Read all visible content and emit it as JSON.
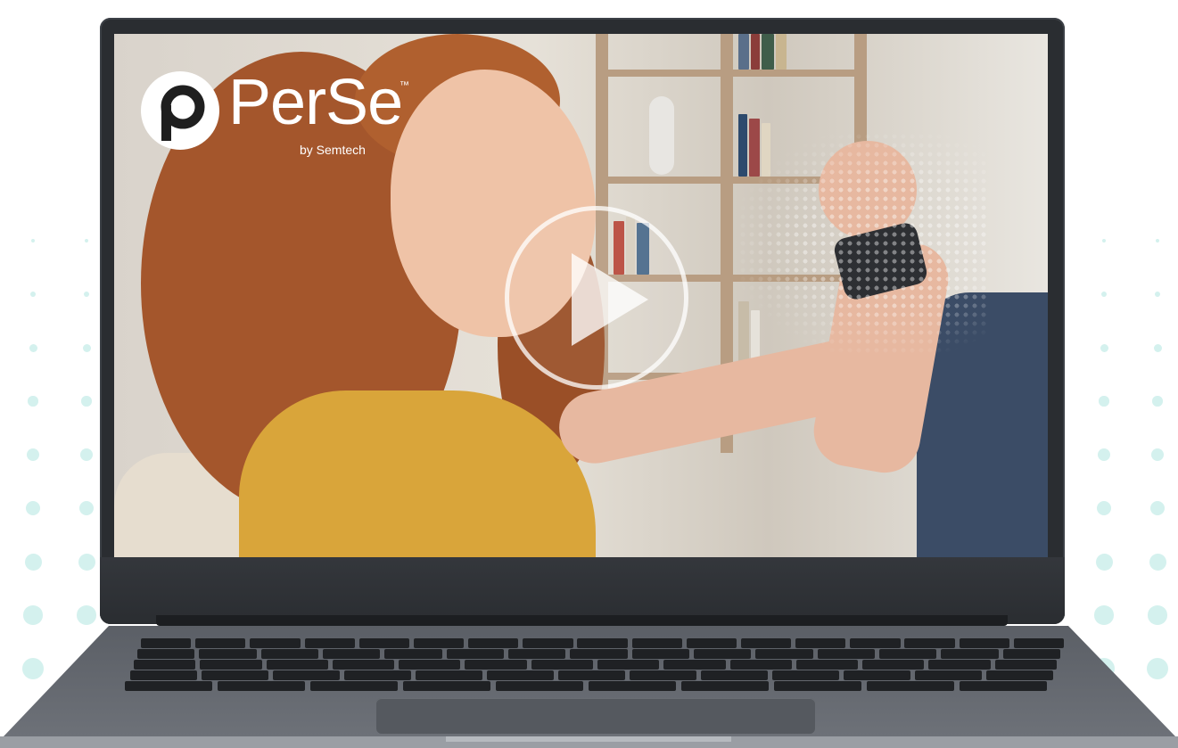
{
  "brand": {
    "name": "PerSe",
    "trademark": "™",
    "byline": "by Semtech",
    "logo_icon": "perse-p-icon"
  },
  "video": {
    "play_icon": "play-icon"
  },
  "colors": {
    "accent_dots": "#d4f1ee",
    "laptop_frame": "#2a2d31",
    "play_overlay": "#ffffff",
    "shirt": "#d9a53a"
  }
}
